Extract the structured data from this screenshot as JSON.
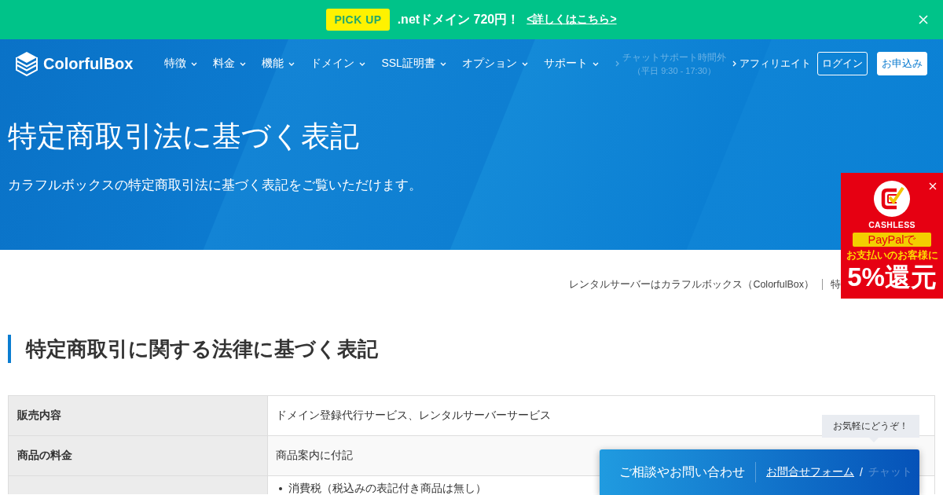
{
  "announcement_bar": {
    "badge": "PICK UP",
    "message": ".netドメイン 720円！",
    "link": "<詳しくはこちら>"
  },
  "header": {
    "logo": "ColorfulBox",
    "nav": [
      {
        "label": "特徴"
      },
      {
        "label": "料金"
      },
      {
        "label": "機能"
      },
      {
        "label": "ドメイン"
      },
      {
        "label": "SSL証明書"
      },
      {
        "label": "オプション"
      },
      {
        "label": "サポート"
      }
    ],
    "support": {
      "label": "チャットサポート時間外",
      "hours": "（平日 9:30 - 17:30）",
      "disabled": true
    },
    "affiliate": "アフィリエイト",
    "buttons": [
      {
        "label": "ログイン",
        "kind": "outline"
      },
      {
        "label": "お申込み",
        "kind": "solid"
      }
    ]
  },
  "hero": {
    "title": "特定商取引法に基づく表記",
    "subtitle": "カラフルボックスの特定商取引法に基づく表記をご覧いただけます。"
  },
  "breadcrumb": [
    "レンタルサーバーはカラフルボックス（ColorfulBox）",
    "特"
  ],
  "section_heading": "特定商取引に関する法律に基づく表記",
  "table": {
    "rows": [
      {
        "kind": "text",
        "label": "販売内容",
        "value": "ドメイン登録代行サービス、レンタルサーバーサービス"
      },
      {
        "kind": "text",
        "label": "商品の料金",
        "value": "商品案内に付記"
      },
      {
        "kind": "list",
        "items": [
          "消費税（税込みの表記付き商品は無し）"
        ]
      }
    ]
  },
  "cashless_badge": {
    "brand": "CASHLESS",
    "highlight": "PayPalで",
    "message": "お支払いのお客様に",
    "offer": "5%還元"
  },
  "chat_widget": {
    "tooltip": "お気軽にどうぞ！",
    "label": "ご相談やお問い合わせ",
    "links": [
      {
        "label": "お問合せフォーム",
        "disabled": false
      },
      {
        "label": "チャット",
        "disabled": true
      }
    ],
    "separator": "/"
  }
}
